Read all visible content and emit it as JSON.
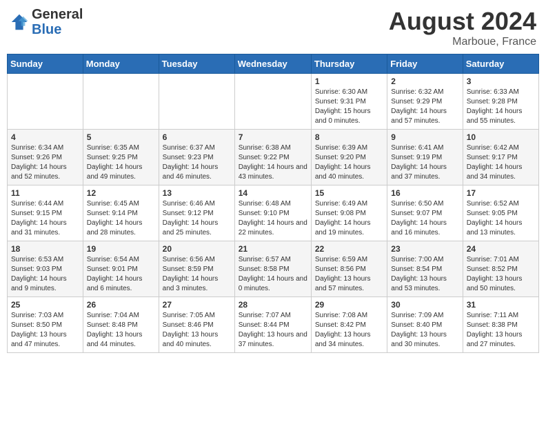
{
  "header": {
    "logo_general": "General",
    "logo_blue": "Blue",
    "main_title": "August 2024",
    "subtitle": "Marboue, France"
  },
  "calendar": {
    "days_of_week": [
      "Sunday",
      "Monday",
      "Tuesday",
      "Wednesday",
      "Thursday",
      "Friday",
      "Saturday"
    ],
    "weeks": [
      [
        {
          "day": "",
          "info": ""
        },
        {
          "day": "",
          "info": ""
        },
        {
          "day": "",
          "info": ""
        },
        {
          "day": "",
          "info": ""
        },
        {
          "day": "1",
          "info": "Sunrise: 6:30 AM\nSunset: 9:31 PM\nDaylight: 15 hours and 0 minutes."
        },
        {
          "day": "2",
          "info": "Sunrise: 6:32 AM\nSunset: 9:29 PM\nDaylight: 14 hours and 57 minutes."
        },
        {
          "day": "3",
          "info": "Sunrise: 6:33 AM\nSunset: 9:28 PM\nDaylight: 14 hours and 55 minutes."
        }
      ],
      [
        {
          "day": "4",
          "info": "Sunrise: 6:34 AM\nSunset: 9:26 PM\nDaylight: 14 hours and 52 minutes."
        },
        {
          "day": "5",
          "info": "Sunrise: 6:35 AM\nSunset: 9:25 PM\nDaylight: 14 hours and 49 minutes."
        },
        {
          "day": "6",
          "info": "Sunrise: 6:37 AM\nSunset: 9:23 PM\nDaylight: 14 hours and 46 minutes."
        },
        {
          "day": "7",
          "info": "Sunrise: 6:38 AM\nSunset: 9:22 PM\nDaylight: 14 hours and 43 minutes."
        },
        {
          "day": "8",
          "info": "Sunrise: 6:39 AM\nSunset: 9:20 PM\nDaylight: 14 hours and 40 minutes."
        },
        {
          "day": "9",
          "info": "Sunrise: 6:41 AM\nSunset: 9:19 PM\nDaylight: 14 hours and 37 minutes."
        },
        {
          "day": "10",
          "info": "Sunrise: 6:42 AM\nSunset: 9:17 PM\nDaylight: 14 hours and 34 minutes."
        }
      ],
      [
        {
          "day": "11",
          "info": "Sunrise: 6:44 AM\nSunset: 9:15 PM\nDaylight: 14 hours and 31 minutes."
        },
        {
          "day": "12",
          "info": "Sunrise: 6:45 AM\nSunset: 9:14 PM\nDaylight: 14 hours and 28 minutes."
        },
        {
          "day": "13",
          "info": "Sunrise: 6:46 AM\nSunset: 9:12 PM\nDaylight: 14 hours and 25 minutes."
        },
        {
          "day": "14",
          "info": "Sunrise: 6:48 AM\nSunset: 9:10 PM\nDaylight: 14 hours and 22 minutes."
        },
        {
          "day": "15",
          "info": "Sunrise: 6:49 AM\nSunset: 9:08 PM\nDaylight: 14 hours and 19 minutes."
        },
        {
          "day": "16",
          "info": "Sunrise: 6:50 AM\nSunset: 9:07 PM\nDaylight: 14 hours and 16 minutes."
        },
        {
          "day": "17",
          "info": "Sunrise: 6:52 AM\nSunset: 9:05 PM\nDaylight: 14 hours and 13 minutes."
        }
      ],
      [
        {
          "day": "18",
          "info": "Sunrise: 6:53 AM\nSunset: 9:03 PM\nDaylight: 14 hours and 9 minutes."
        },
        {
          "day": "19",
          "info": "Sunrise: 6:54 AM\nSunset: 9:01 PM\nDaylight: 14 hours and 6 minutes."
        },
        {
          "day": "20",
          "info": "Sunrise: 6:56 AM\nSunset: 8:59 PM\nDaylight: 14 hours and 3 minutes."
        },
        {
          "day": "21",
          "info": "Sunrise: 6:57 AM\nSunset: 8:58 PM\nDaylight: 14 hours and 0 minutes."
        },
        {
          "day": "22",
          "info": "Sunrise: 6:59 AM\nSunset: 8:56 PM\nDaylight: 13 hours and 57 minutes."
        },
        {
          "day": "23",
          "info": "Sunrise: 7:00 AM\nSunset: 8:54 PM\nDaylight: 13 hours and 53 minutes."
        },
        {
          "day": "24",
          "info": "Sunrise: 7:01 AM\nSunset: 8:52 PM\nDaylight: 13 hours and 50 minutes."
        }
      ],
      [
        {
          "day": "25",
          "info": "Sunrise: 7:03 AM\nSunset: 8:50 PM\nDaylight: 13 hours and 47 minutes."
        },
        {
          "day": "26",
          "info": "Sunrise: 7:04 AM\nSunset: 8:48 PM\nDaylight: 13 hours and 44 minutes."
        },
        {
          "day": "27",
          "info": "Sunrise: 7:05 AM\nSunset: 8:46 PM\nDaylight: 13 hours and 40 minutes."
        },
        {
          "day": "28",
          "info": "Sunrise: 7:07 AM\nSunset: 8:44 PM\nDaylight: 13 hours and 37 minutes."
        },
        {
          "day": "29",
          "info": "Sunrise: 7:08 AM\nSunset: 8:42 PM\nDaylight: 13 hours and 34 minutes."
        },
        {
          "day": "30",
          "info": "Sunrise: 7:09 AM\nSunset: 8:40 PM\nDaylight: 13 hours and 30 minutes."
        },
        {
          "day": "31",
          "info": "Sunrise: 7:11 AM\nSunset: 8:38 PM\nDaylight: 13 hours and 27 minutes."
        }
      ]
    ]
  }
}
